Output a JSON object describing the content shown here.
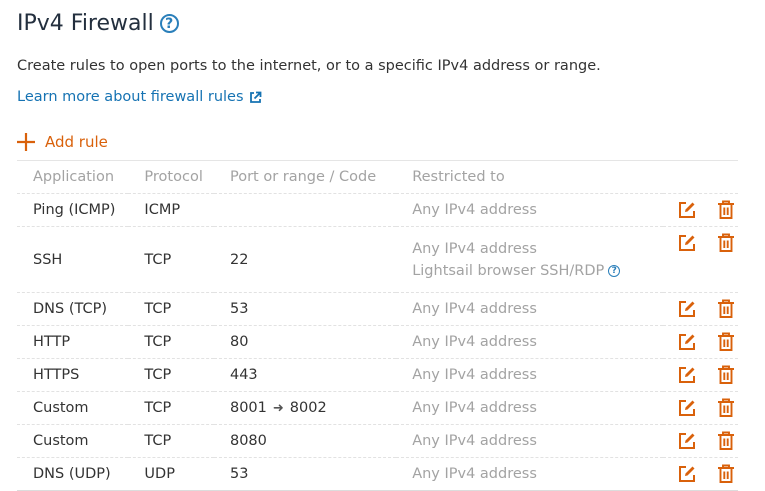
{
  "header": {
    "title": "IPv4 Firewall",
    "help_glyph": "?",
    "description": "Create rules to open ports to the internet, or to a specific IPv4 address or range.",
    "learn_more": "Learn more about firewall rules"
  },
  "add_rule_label": "Add rule",
  "columns": [
    "Application",
    "Protocol",
    "Port or range / Code",
    "Restricted to"
  ],
  "rows": [
    {
      "application": "Ping (ICMP)",
      "protocol": "ICMP",
      "port": "",
      "restricted": "Any IPv4 address"
    },
    {
      "application": "SSH",
      "protocol": "TCP",
      "port": "22",
      "restricted": "Any IPv4 address",
      "restricted_extra": "Lightsail browser SSH/RDP"
    },
    {
      "application": "DNS (TCP)",
      "protocol": "TCP",
      "port": "53",
      "restricted": "Any IPv4 address"
    },
    {
      "application": "HTTP",
      "protocol": "TCP",
      "port": "80",
      "restricted": "Any IPv4 address"
    },
    {
      "application": "HTTPS",
      "protocol": "TCP",
      "port": "443",
      "restricted": "Any IPv4 address"
    },
    {
      "application": "Custom",
      "protocol": "TCP",
      "port_from": "8001",
      "port_to": "8002",
      "restricted": "Any IPv4 address"
    },
    {
      "application": "Custom",
      "protocol": "TCP",
      "port": "8080",
      "restricted": "Any IPv4 address"
    },
    {
      "application": "DNS (UDP)",
      "protocol": "UDP",
      "port": "53",
      "restricted": "Any IPv4 address"
    }
  ],
  "icons": {
    "edit": "edit-icon",
    "delete": "trash-icon",
    "add": "plus-icon",
    "external": "external-link-icon",
    "help": "help-circle-icon"
  },
  "colors": {
    "accent": "#d9610b",
    "link": "#1673b3",
    "help": "#2a7fba",
    "muted": "#a3a3a3"
  }
}
